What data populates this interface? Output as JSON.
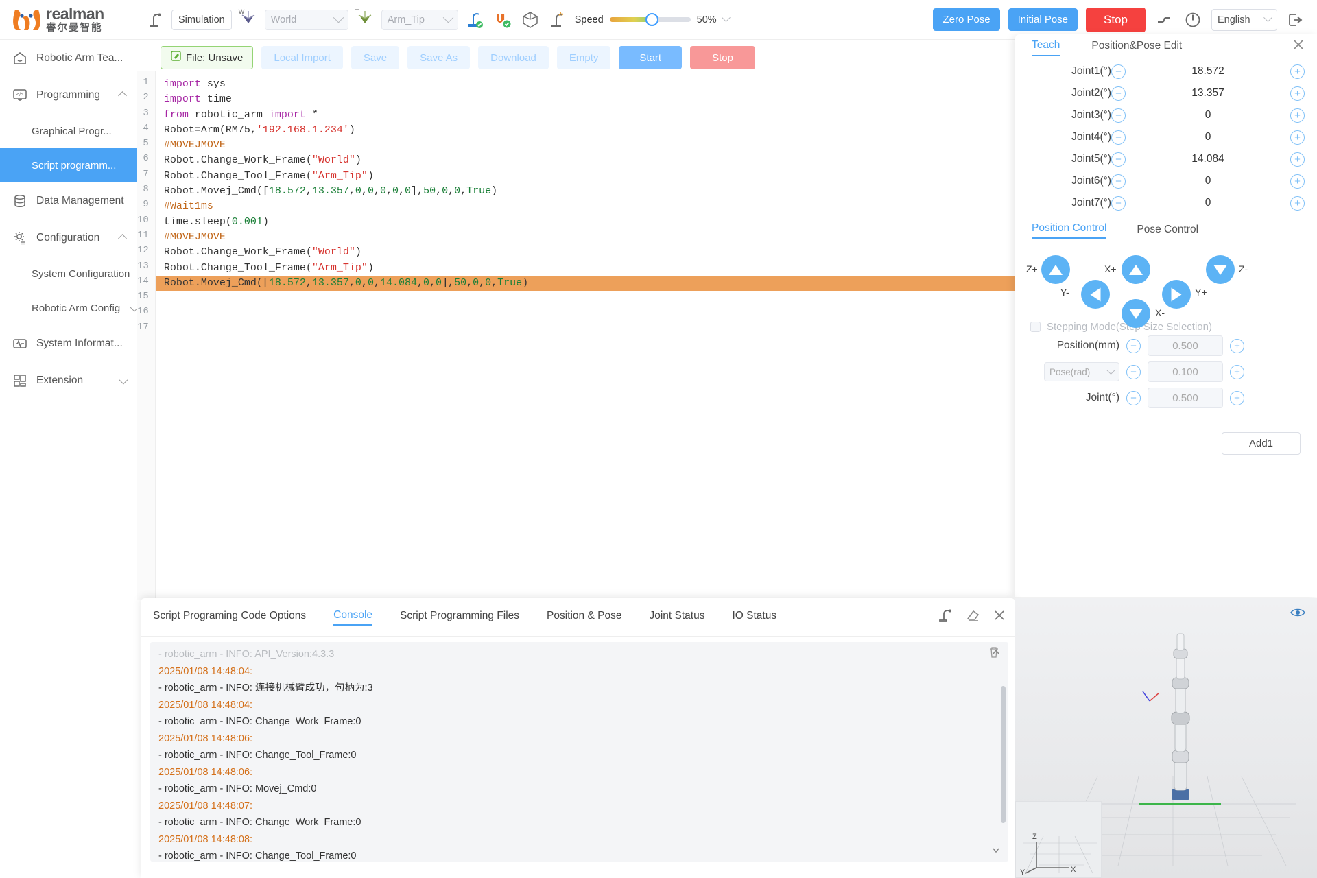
{
  "header": {
    "logo_en": "realman",
    "logo_cn": "睿尔曼智能",
    "mode_label": "Simulation",
    "work_frame": "World",
    "work_frame_tag": "W",
    "tool_frame": "Arm_Tip",
    "tool_frame_tag": "T",
    "speed_label": "Speed",
    "speed_percent": "50%",
    "zero_pose": "Zero Pose",
    "initial_pose": "Initial Pose",
    "stop": "Stop",
    "language": "English",
    "icons": [
      "teach-pendant-icon",
      "work-frame-axis-icon",
      "tool-frame-axis-icon",
      "arm-connected-icon",
      "cable-connected-icon",
      "cube-icon",
      "simulation-arm-icon",
      "drag-teach-icon",
      "power-icon",
      "logout-icon"
    ]
  },
  "sidebar": {
    "items": [
      {
        "label": "Robotic Arm Tea...",
        "icon": "home-icon",
        "active": false,
        "sub": false,
        "chev": ""
      },
      {
        "label": "Programming",
        "icon": "code-monitor-icon",
        "active": false,
        "sub": false,
        "chev": "up"
      },
      {
        "label": "Graphical Progr...",
        "icon": "",
        "active": false,
        "sub": true,
        "chev": ""
      },
      {
        "label": "Script programm...",
        "icon": "",
        "active": true,
        "sub": true,
        "chev": ""
      },
      {
        "label": "Data Management",
        "icon": "database-icon",
        "active": false,
        "sub": false,
        "chev": ""
      },
      {
        "label": "Configuration",
        "icon": "gear-icon",
        "active": false,
        "sub": false,
        "chev": "up"
      },
      {
        "label": "System Configuration",
        "icon": "",
        "active": false,
        "sub": true,
        "chev": ""
      },
      {
        "label": "Robotic Arm Config.",
        "icon": "",
        "active": false,
        "sub": true,
        "chev": "down-inline"
      },
      {
        "label": "System Informat...",
        "icon": "wave-icon",
        "active": false,
        "sub": false,
        "chev": ""
      },
      {
        "label": "Extension",
        "icon": "grid-icon",
        "active": false,
        "sub": false,
        "chev": "down"
      }
    ]
  },
  "filebar": {
    "file_label": "File: Unsave",
    "buttons": [
      "Local Import",
      "Save",
      "Save As",
      "Download",
      "Empty"
    ],
    "start": "Start",
    "stop": "Stop"
  },
  "editor": {
    "highlight_line": 14,
    "total_lines": 17,
    "lines": [
      {
        "n": 1,
        "tokens": [
          {
            "t": "import",
            "c": "kw"
          },
          {
            "t": " sys",
            "c": ""
          }
        ]
      },
      {
        "n": 2,
        "tokens": [
          {
            "t": "import",
            "c": "kw"
          },
          {
            "t": " time",
            "c": ""
          }
        ]
      },
      {
        "n": 3,
        "tokens": [
          {
            "t": "from",
            "c": "kw"
          },
          {
            "t": " robotic_arm ",
            "c": ""
          },
          {
            "t": "import",
            "c": "kw"
          },
          {
            "t": " *",
            "c": ""
          }
        ]
      },
      {
        "n": 4,
        "tokens": [
          {
            "t": "Robot=Arm(RM75,",
            "c": ""
          },
          {
            "t": "'192.168.1.234'",
            "c": "str"
          },
          {
            "t": ")",
            "c": ""
          }
        ]
      },
      {
        "n": 5,
        "tokens": [
          {
            "t": "#MOVEJMOVE",
            "c": "com"
          }
        ]
      },
      {
        "n": 6,
        "tokens": [
          {
            "t": "Robot.Change_Work_Frame(",
            "c": ""
          },
          {
            "t": "\"World\"",
            "c": "str"
          },
          {
            "t": ")",
            "c": ""
          }
        ]
      },
      {
        "n": 7,
        "tokens": [
          {
            "t": "Robot.Change_Tool_Frame(",
            "c": ""
          },
          {
            "t": "\"Arm_Tip\"",
            "c": "str"
          },
          {
            "t": ")",
            "c": ""
          }
        ]
      },
      {
        "n": 8,
        "tokens": [
          {
            "t": "Robot.Movej_Cmd([",
            "c": ""
          },
          {
            "t": "18.572",
            "c": "num"
          },
          {
            "t": ",",
            "c": ""
          },
          {
            "t": "13.357",
            "c": "num"
          },
          {
            "t": ",",
            "c": ""
          },
          {
            "t": "0",
            "c": "num"
          },
          {
            "t": ",",
            "c": ""
          },
          {
            "t": "0",
            "c": "num"
          },
          {
            "t": ",",
            "c": ""
          },
          {
            "t": "0",
            "c": "num"
          },
          {
            "t": ",",
            "c": ""
          },
          {
            "t": "0",
            "c": "num"
          },
          {
            "t": ",",
            "c": ""
          },
          {
            "t": "0",
            "c": "num"
          },
          {
            "t": "],",
            "c": ""
          },
          {
            "t": "50",
            "c": "num"
          },
          {
            "t": ",",
            "c": ""
          },
          {
            "t": "0",
            "c": "num"
          },
          {
            "t": ",",
            "c": ""
          },
          {
            "t": "0",
            "c": "num"
          },
          {
            "t": ",",
            "c": ""
          },
          {
            "t": "True",
            "c": "num"
          },
          {
            "t": ")",
            "c": ""
          }
        ]
      },
      {
        "n": 9,
        "tokens": [
          {
            "t": "#Wait1ms",
            "c": "com"
          }
        ]
      },
      {
        "n": 10,
        "tokens": [
          {
            "t": "time.sleep(",
            "c": ""
          },
          {
            "t": "0.001",
            "c": "num"
          },
          {
            "t": ")",
            "c": ""
          }
        ]
      },
      {
        "n": 11,
        "tokens": [
          {
            "t": "#MOVEJMOVE",
            "c": "com"
          }
        ]
      },
      {
        "n": 12,
        "tokens": [
          {
            "t": "Robot.Change_Work_Frame(",
            "c": ""
          },
          {
            "t": "\"World\"",
            "c": "str"
          },
          {
            "t": ")",
            "c": ""
          }
        ]
      },
      {
        "n": 13,
        "tokens": [
          {
            "t": "Robot.Change_Tool_Frame(",
            "c": ""
          },
          {
            "t": "\"Arm_Tip\"",
            "c": "str"
          },
          {
            "t": ")",
            "c": ""
          }
        ]
      },
      {
        "n": 14,
        "tokens": [
          {
            "t": "Robot.Movej_Cmd([",
            "c": ""
          },
          {
            "t": "18.572",
            "c": "num"
          },
          {
            "t": ",",
            "c": ""
          },
          {
            "t": "13.357",
            "c": "num"
          },
          {
            "t": ",",
            "c": ""
          },
          {
            "t": "0",
            "c": "num"
          },
          {
            "t": ",",
            "c": ""
          },
          {
            "t": "0",
            "c": "num"
          },
          {
            "t": ",",
            "c": ""
          },
          {
            "t": "14.084",
            "c": "num"
          },
          {
            "t": ",",
            "c": ""
          },
          {
            "t": "0",
            "c": "num"
          },
          {
            "t": ",",
            "c": ""
          },
          {
            "t": "0",
            "c": "num"
          },
          {
            "t": "],",
            "c": ""
          },
          {
            "t": "50",
            "c": "num"
          },
          {
            "t": ",",
            "c": ""
          },
          {
            "t": "0",
            "c": "num"
          },
          {
            "t": ",",
            "c": ""
          },
          {
            "t": "0",
            "c": "num"
          },
          {
            "t": ",",
            "c": ""
          },
          {
            "t": "True",
            "c": "num"
          },
          {
            "t": ")",
            "c": ""
          }
        ]
      },
      {
        "n": 15,
        "tokens": []
      },
      {
        "n": 16,
        "tokens": []
      },
      {
        "n": 17,
        "tokens": []
      }
    ]
  },
  "teach_panel": {
    "tabs": [
      {
        "label": "Teach",
        "active": true
      },
      {
        "label": "Position&Pose Edit",
        "active": false
      }
    ],
    "close_icon": "close-icon",
    "joints": [
      {
        "label": "Joint1(°)",
        "value": "18.572"
      },
      {
        "label": "Joint2(°)",
        "value": "13.357"
      },
      {
        "label": "Joint3(°)",
        "value": "0"
      },
      {
        "label": "Joint4(°)",
        "value": "0"
      },
      {
        "label": "Joint5(°)",
        "value": "14.084"
      },
      {
        "label": "Joint6(°)",
        "value": "0"
      },
      {
        "label": "Joint7(°)",
        "value": "0"
      }
    ],
    "minus": "−",
    "plus": "+",
    "control_tabs": [
      {
        "label": "Position Control",
        "active": true
      },
      {
        "label": "Pose Control",
        "active": false
      }
    ],
    "axes": [
      "Z+",
      "X+",
      "Z-",
      "Y-",
      "Y+",
      "X-"
    ],
    "stepping_mode": "Stepping Mode(Step Size Selection)",
    "steps": [
      {
        "label": "Position(mm)",
        "value": "0.500",
        "select": null
      },
      {
        "label": "",
        "value": "0.100",
        "select": "Pose(rad)"
      },
      {
        "label": "Joint(°)",
        "value": "0.500",
        "select": null
      }
    ],
    "add_button": "Add1"
  },
  "console": {
    "tabs": [
      {
        "label": "Script Programing Code Options",
        "active": false
      },
      {
        "label": "Console",
        "active": true
      },
      {
        "label": "Script Programming Files",
        "active": false
      },
      {
        "label": "Position & Pose",
        "active": false
      },
      {
        "label": "Joint Status",
        "active": false
      },
      {
        "label": "IO Status",
        "active": false
      }
    ],
    "tool_icons": [
      "run-script-icon",
      "eraser-icon",
      "close-icon"
    ],
    "trash_icon": "trash-icon",
    "lines": [
      {
        "text": "- robotic_arm - INFO: API_Version:4.3.3",
        "type": "fade"
      },
      {
        "text": "2025/01/08 14:48:04:",
        "type": "ts"
      },
      {
        "text": "- robotic_arm - INFO: 连接机械臂成功，句柄为:3",
        "type": "msg"
      },
      {
        "text": "2025/01/08 14:48:04:",
        "type": "ts"
      },
      {
        "text": "- robotic_arm - INFO: Change_Work_Frame:0",
        "type": "msg"
      },
      {
        "text": "2025/01/08 14:48:06:",
        "type": "ts"
      },
      {
        "text": "- robotic_arm - INFO: Change_Tool_Frame:0",
        "type": "msg"
      },
      {
        "text": "2025/01/08 14:48:06:",
        "type": "ts"
      },
      {
        "text": "- robotic_arm - INFO: Movej_Cmd:0",
        "type": "msg"
      },
      {
        "text": "2025/01/08 14:48:07:",
        "type": "ts"
      },
      {
        "text": "- robotic_arm - INFO: Change_Work_Frame:0",
        "type": "msg"
      },
      {
        "text": "2025/01/08 14:48:08:",
        "type": "ts"
      },
      {
        "text": "- robotic_arm - INFO: Change_Tool_Frame:0",
        "type": "msg"
      }
    ]
  },
  "view3d": {
    "eye_icon": "eye-visible-icon",
    "axis_z": "Z",
    "axis_y": "Y",
    "axis_x": "X"
  },
  "colors": {
    "accent": "#4aa3f5",
    "danger": "#f5413f",
    "brand": "#ef7d22",
    "highlight_row": "#eda05a"
  }
}
